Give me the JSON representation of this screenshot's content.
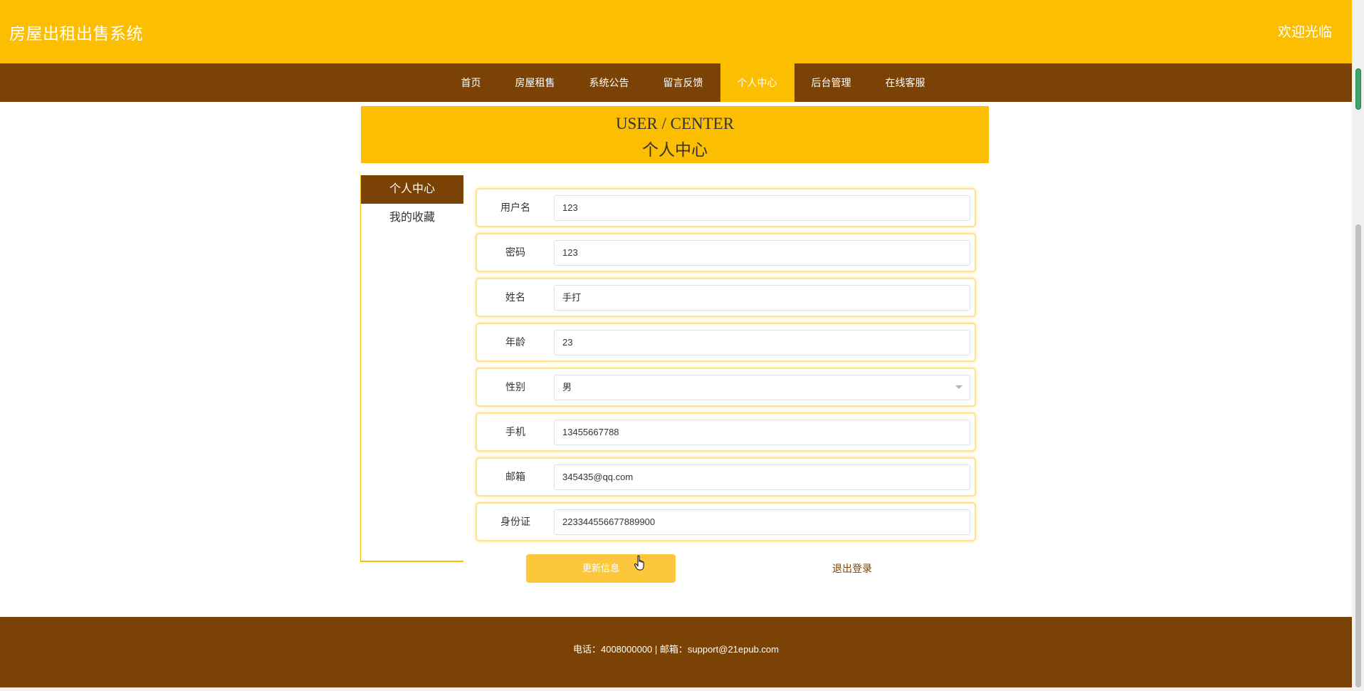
{
  "header": {
    "site_title": "房屋出租出售系统",
    "welcome": "欢迎光临"
  },
  "nav": {
    "items": [
      {
        "label": "首页",
        "active": false
      },
      {
        "label": "房屋租售",
        "active": false
      },
      {
        "label": "系统公告",
        "active": false
      },
      {
        "label": "留言反馈",
        "active": false
      },
      {
        "label": "个人中心",
        "active": true
      },
      {
        "label": "后台管理",
        "active": false
      },
      {
        "label": "在线客服",
        "active": false
      }
    ]
  },
  "banner": {
    "en": "USER / CENTER",
    "cn": "个人中心"
  },
  "sidebar": {
    "items": [
      {
        "label": "个人中心",
        "active": true
      },
      {
        "label": "我的收藏",
        "active": false
      }
    ]
  },
  "form": {
    "fields": [
      {
        "label": "用户名",
        "value": "123",
        "type": "text"
      },
      {
        "label": "密码",
        "value": "123",
        "type": "text"
      },
      {
        "label": "姓名",
        "value": "手打",
        "type": "text"
      },
      {
        "label": "年龄",
        "value": "23",
        "type": "text"
      },
      {
        "label": "性别",
        "value": "男",
        "type": "select"
      },
      {
        "label": "手机",
        "value": "13455667788",
        "type": "text"
      },
      {
        "label": "邮箱",
        "value": "345435@qq.com",
        "type": "text"
      },
      {
        "label": "身份证",
        "value": "223344556677889900",
        "type": "text"
      }
    ],
    "update_button": "更新信息",
    "logout_link": "退出登录"
  },
  "footer": {
    "text": "电话：4008000000 | 邮箱：support@21epub.com"
  },
  "colors": {
    "primary": "#fcbe00",
    "dark": "#7a4305",
    "button": "#fcc73a"
  }
}
